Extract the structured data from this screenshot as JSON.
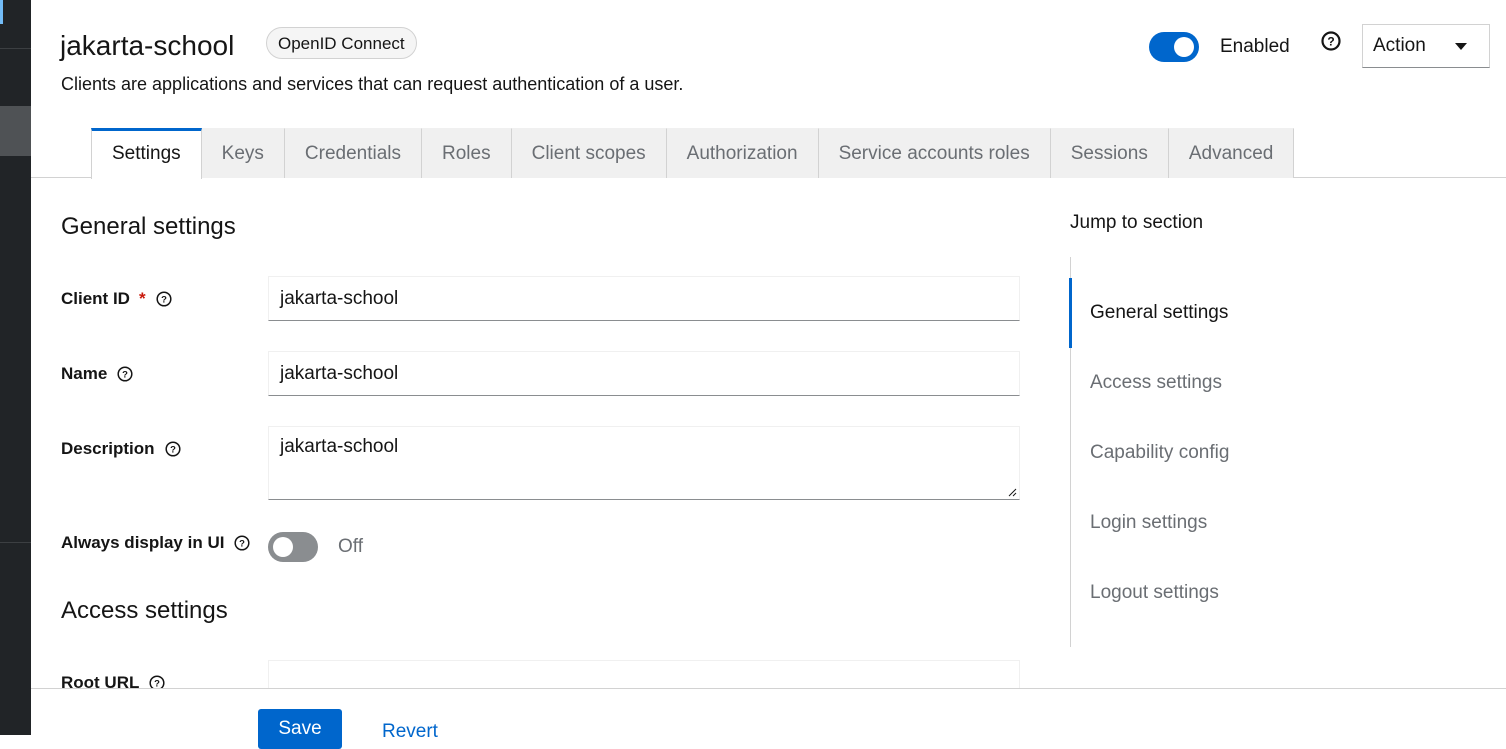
{
  "header": {
    "title": "jakarta-school",
    "protocol_badge": "OpenID Connect",
    "subtitle": "Clients are applications and services that can request authentication of a user.",
    "enabled_label": "Enabled",
    "enabled": true,
    "action_label": "Action",
    "help_icon": "question-circle-icon"
  },
  "tabs": [
    {
      "label": "Settings",
      "active": true
    },
    {
      "label": "Keys"
    },
    {
      "label": "Credentials"
    },
    {
      "label": "Roles"
    },
    {
      "label": "Client scopes"
    },
    {
      "label": "Authorization"
    },
    {
      "label": "Service accounts roles"
    },
    {
      "label": "Sessions"
    },
    {
      "label": "Advanced"
    }
  ],
  "general": {
    "title": "General settings",
    "client_id_label": "Client ID",
    "required_mark": "*",
    "client_id_value": "jakarta-school",
    "name_label": "Name",
    "name_value": "jakarta-school",
    "description_label": "Description",
    "description_value": "jakarta-school",
    "always_display_label": "Always display in UI",
    "always_display_state": "Off"
  },
  "access": {
    "title": "Access settings",
    "root_url_label": "Root URL",
    "root_url_value": ""
  },
  "jump": {
    "title": "Jump to section",
    "links": [
      "General settings",
      "Access settings",
      "Capability config",
      "Login settings",
      "Logout settings"
    ],
    "active_index": 0
  },
  "footer": {
    "save_label": "Save",
    "revert_label": "Revert"
  },
  "colors": {
    "primary": "#0066cc",
    "sidebar": "#212427",
    "required": "#c9190b"
  }
}
